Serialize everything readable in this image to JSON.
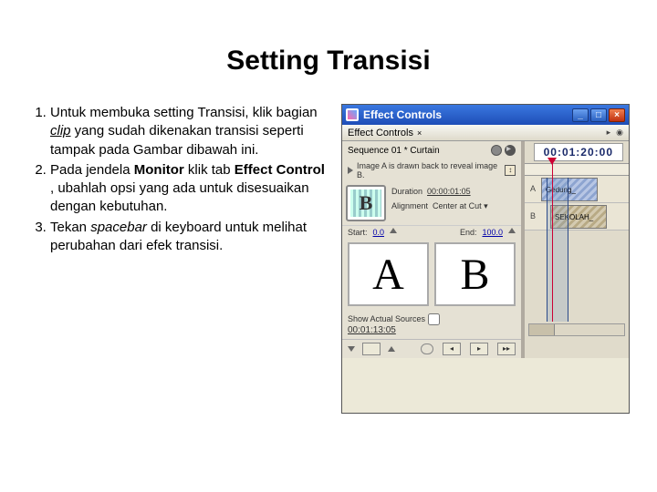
{
  "title": "Setting Transisi",
  "steps": {
    "s1a": "Untuk membuka setting Transisi, klik bagian ",
    "s1b": "clip",
    "s1c": " yang sudah dikenakan transisi seperti tampak pada Gambar dibawah ini.",
    "s2a": "Pada jendela ",
    "s2b": "Monitor",
    "s2c": " klik tab ",
    "s2d": "Effect Control",
    "s2e": " , ubahlah opsi yang ada untuk disesuaikan dengan kebutuhan.",
    "s3a": "Tekan ",
    "s3b": "spacebar",
    "s3c": " di keyboard untuk melihat perubahan dari efek transisi."
  },
  "window": {
    "title": "Effect Controls",
    "tab": "Effect Controls",
    "tabclose": "×",
    "helpTri": "▸",
    "helpCirc": "◉",
    "sequence": "Sequence 01 * Curtain",
    "drawn": "Image A is drawn back to reveal image B.",
    "durationLabel": "Duration",
    "durationVal": "00:00:01:05",
    "alignLabel": "Alignment",
    "alignVal": "Center at Cut ▾",
    "startLabel": "Start:",
    "startVal": "0.0",
    "endLabel": "End:",
    "endVal": "100.0",
    "showActual": "Show Actual Sources",
    "currentTime": "00:01:13:05",
    "headerTc": "00:01:20:00",
    "trackA": "A",
    "trackB": "B",
    "clipA": "Gedung_",
    "clipB": "SEKOLAH_",
    "btnMin": "_",
    "btnMax": "□",
    "btnClose": "×",
    "g_A": "A",
    "g_B": "B",
    "g_bB": "B"
  }
}
